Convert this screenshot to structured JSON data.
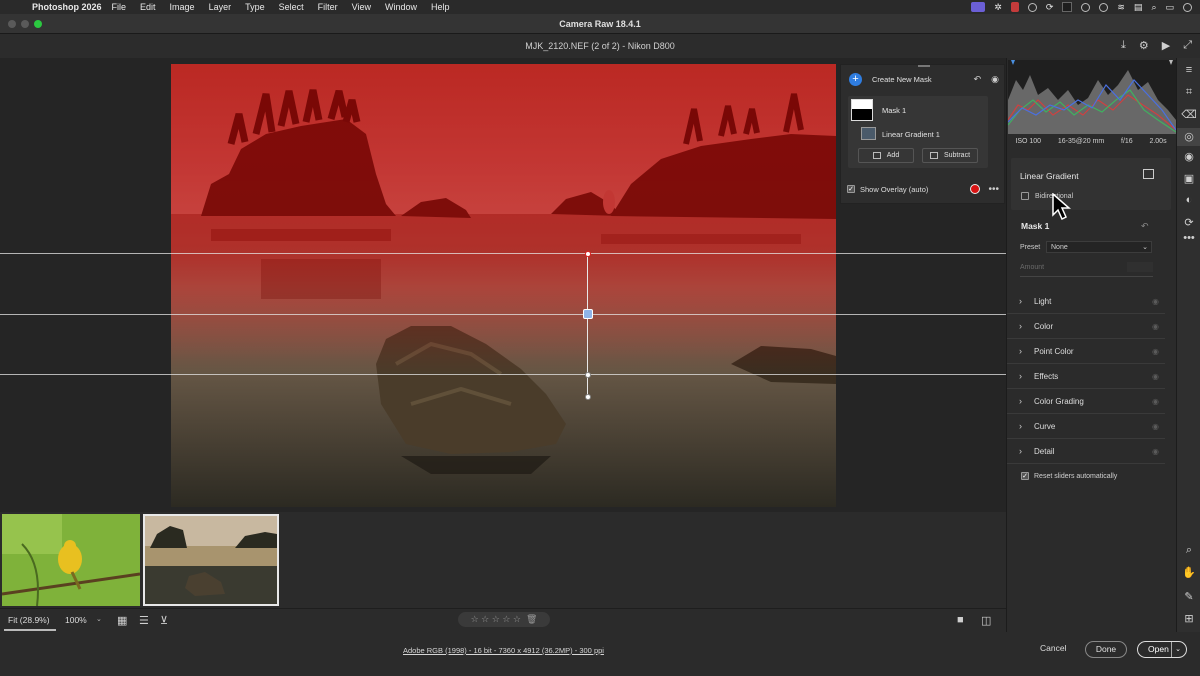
{
  "menubar": {
    "apple_icon": "",
    "app_name": "Photoshop 2026",
    "items": [
      "File",
      "Edit",
      "Image",
      "Layer",
      "Type",
      "Select",
      "Filter",
      "View",
      "Window",
      "Help"
    ]
  },
  "window": {
    "title": "Camera Raw 18.4.1",
    "file_title": "MJK_2120.NEF (2 of 2)  -  Nikon D800"
  },
  "header_icons": [
    "download-icon",
    "gear-icon",
    "play-icon",
    "fullscreen-icon"
  ],
  "mask_panel": {
    "create_label": "Create New Mask",
    "mask_name": "Mask 1",
    "component_name": "Linear Gradient 1",
    "add_label": "Add",
    "subtract_label": "Subtract",
    "show_overlay_label": "Show Overlay (auto)",
    "show_overlay_checked": true,
    "overlay_color": "#d81414"
  },
  "histogram_info": {
    "iso": "ISO 100",
    "lens": "16-35@20 mm",
    "aperture": "f/16",
    "shutter": "2.00s"
  },
  "linear_gradient": {
    "title": "Linear Gradient",
    "bidirectional_label": "Bidirectional",
    "bidirectional_checked": false
  },
  "mask_settings": {
    "title": "Mask 1",
    "preset_label": "Preset",
    "preset_value": "None",
    "amount_label": "Amount"
  },
  "sections": [
    "Light",
    "Color",
    "Point Color",
    "Effects",
    "Color Grading",
    "Curve",
    "Detail"
  ],
  "reset_sliders_label": "Reset sliders automatically",
  "reset_sliders_checked": true,
  "bottom_toolbar": {
    "zoom_fit": "Fit (28.9%)",
    "zoom_100": "100%",
    "stars": "☆ ☆ ☆ ☆ ☆",
    "trash": "🗑"
  },
  "status_bar": {
    "file_info": "Adobe RGB (1998) - 16 bit - 7360 x 4912 (36.2MP) - 300 ppi",
    "cancel_label": "Cancel",
    "done_label": "Done",
    "open_label": "Open"
  },
  "colors": {
    "accent_blue": "#2f7de0",
    "overlay_red": "#d81414"
  }
}
